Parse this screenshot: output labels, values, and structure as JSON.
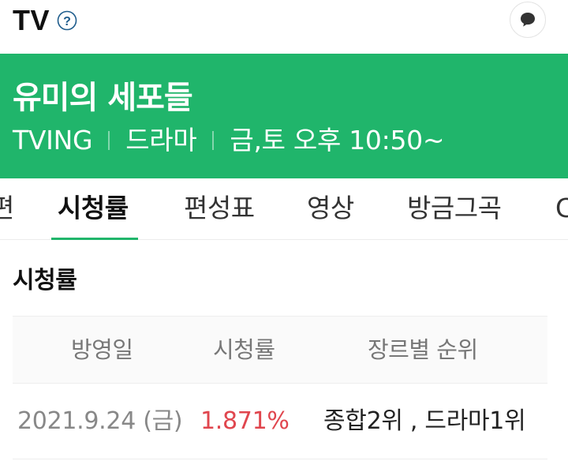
{
  "topbar": {
    "title": "TV",
    "help_icon": "question-circle-icon",
    "chat_icon": "chat-bubble-icon"
  },
  "program": {
    "title": "유미의 세포들",
    "channel": "TVING",
    "genre": "드라마",
    "schedule": "금,토 오후 10:50~"
  },
  "tabs": [
    {
      "label": "편",
      "active": false
    },
    {
      "label": "시청률",
      "active": true
    },
    {
      "label": "편성표",
      "active": false
    },
    {
      "label": "영상",
      "active": false
    },
    {
      "label": "방금그곡",
      "active": false
    },
    {
      "label": "C",
      "active": false
    }
  ],
  "section": {
    "title": "시청률"
  },
  "rating_table": {
    "headers": [
      "방영일",
      "시청률",
      "장르별 순위"
    ],
    "rows": [
      {
        "date": "2021.9.24 (금)",
        "rating": "1.871%",
        "rank": "종합2위 , 드라마1위"
      }
    ]
  },
  "colors": {
    "brand_green": "#20b56b",
    "rating_red": "#e0464e"
  }
}
